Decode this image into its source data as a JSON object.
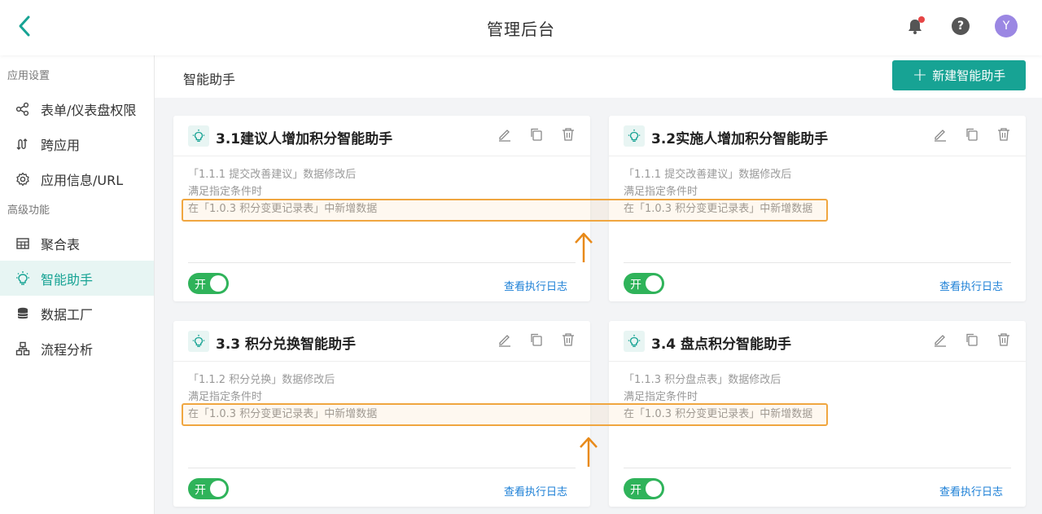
{
  "header": {
    "title": "管理后台",
    "avatar_letter": "Y"
  },
  "sidebar": {
    "sections": [
      {
        "label": "应用设置"
      },
      {
        "label": "高级功能"
      }
    ],
    "items": [
      {
        "label": "表单/仪表盘权限",
        "icon": "share-icon"
      },
      {
        "label": "跨应用",
        "icon": "cross-app-icon"
      },
      {
        "label": "应用信息/URL",
        "icon": "gear-icon"
      },
      {
        "label": "聚合表",
        "icon": "table-icon"
      },
      {
        "label": "智能助手",
        "icon": "bulb-icon",
        "active": true
      },
      {
        "label": "数据工厂",
        "icon": "database-icon"
      },
      {
        "label": "流程分析",
        "icon": "flow-icon"
      }
    ]
  },
  "main": {
    "title": "智能助手",
    "new_button_label": "新建智能助手",
    "new_button_plus": "+"
  },
  "cards": [
    {
      "title": "3.1建议人增加积分智能助手",
      "line1": "「1.1.1 提交改善建议」数据修改后",
      "line2": "满足指定条件时",
      "line3": "在「1.0.3 积分变更记录表」中新增数据",
      "toggle_label": "开",
      "log_link": "查看执行日志"
    },
    {
      "title": "3.2实施人增加积分智能助手",
      "line1": "「1.1.1 提交改善建议」数据修改后",
      "line2": "满足指定条件时",
      "line3": "在「1.0.3 积分变更记录表」中新增数据",
      "toggle_label": "开",
      "log_link": "查看执行日志"
    },
    {
      "title": "3.3 积分兑换智能助手",
      "line1": "「1.1.2 积分兑换」数据修改后",
      "line2": "满足指定条件时",
      "line3": "在「1.0.3 积分变更记录表」中新增数据",
      "toggle_label": "开",
      "log_link": "查看执行日志"
    },
    {
      "title": "3.4 盘点积分智能助手",
      "line1": "「1.1.3 积分盘点表」数据修改后",
      "line2": "满足指定条件时",
      "line3": "在「1.0.3 积分变更记录表」中新增数据",
      "toggle_label": "开",
      "log_link": "查看执行日志"
    }
  ],
  "colors": {
    "accent": "#17a394",
    "toggle_on": "#2fb35a",
    "link": "#1b7fd6",
    "highlight": "#f0a640",
    "avatar": "#9b87e3",
    "notification_dot": "#e64545"
  }
}
